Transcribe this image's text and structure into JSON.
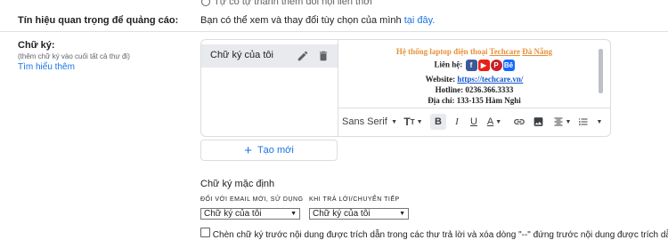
{
  "top_cut_text": "Tự có tự thanh thêm đối nội liên thời",
  "ad_signals": {
    "title": "Tín hiệu quan trọng để quảng cáo:",
    "text": "Bạn có thể xem và thay đổi tùy chọn của mình",
    "link": "tại đây."
  },
  "signature": {
    "title": "Chữ ký:",
    "subtitle": "(thêm chữ ký vào cuối tất cả thư đi)",
    "learn_more": "Tìm hiểu thêm",
    "item_label": "Chữ ký của tôi",
    "content": {
      "headline_prefix": "Hệ thống laptop điện thoại",
      "headline_brand": "Techcare",
      "headline_city": "Đà Nẵng",
      "contact_label": "Liên hệ:",
      "website_label": "Website:",
      "website_url": "https://techcare.vn/",
      "hotline_label": "Hotline:",
      "hotline_value": "0236.366.3333",
      "address_label": "Địa chỉ:",
      "address_value": "133-135 Hàm Nghi",
      "social_icons": [
        "facebook",
        "youtube",
        "pinterest",
        "behance"
      ]
    },
    "toolbar": {
      "font": "Sans Serif"
    },
    "new_button": "Tạo mới"
  },
  "defaults": {
    "title": "Chữ ký mặc định",
    "new_email_label": "ĐỐI VỚI EMAIL MỚI, SỬ DỤNG",
    "reply_label": "KHI TRẢ LỜI/CHUYỂN TIẾP",
    "new_email_value": "Chữ ký của tôi",
    "reply_value": "Chữ ký của tôi",
    "bottom_checkbox_text": "Chèn chữ ký trước nội dung được trích dẫn trong các thư trả lời và xóa dòng \"--\" đứng trước nội dung được trích dẫn"
  },
  "colors": {
    "headline": "#e69138",
    "link": "#1a73e8",
    "facebook": "#3b5998",
    "youtube": "#e62117",
    "pinterest": "#cb2027",
    "behance": "#1769ff"
  }
}
